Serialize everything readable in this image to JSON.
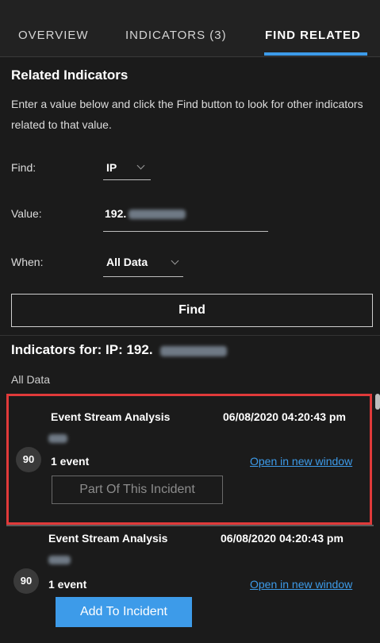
{
  "tabs": {
    "overview": "OVERVIEW",
    "indicators": "INDICATORS (3)",
    "find_related": "FIND RELATED"
  },
  "related": {
    "title": "Related Indicators",
    "help": "Enter a value below and click the Find button to look for other indicators related to that value."
  },
  "form": {
    "find_label": "Find:",
    "find_value": "IP",
    "value_label": "Value:",
    "value_text": "192.",
    "when_label": "When:",
    "when_value": "All Data",
    "find_button": "Find"
  },
  "results": {
    "title": "Indicators for: IP: 192.",
    "timeframe": "All Data",
    "items": [
      {
        "source": "Event Stream Analysis",
        "date": "06/08/2020 04:20:43 pm",
        "score": "90",
        "events": "1 event",
        "open_link": "Open in new window",
        "action": "Part Of This Incident"
      },
      {
        "source": "Event Stream Analysis",
        "date": "06/08/2020 04:20:43 pm",
        "score": "90",
        "events": "1 event",
        "open_link": "Open in new window",
        "action": "Add To Incident"
      }
    ]
  },
  "colors": {
    "accent": "#3d9be9",
    "highlight": "#e03a3a",
    "background": "#1b1b1b"
  }
}
